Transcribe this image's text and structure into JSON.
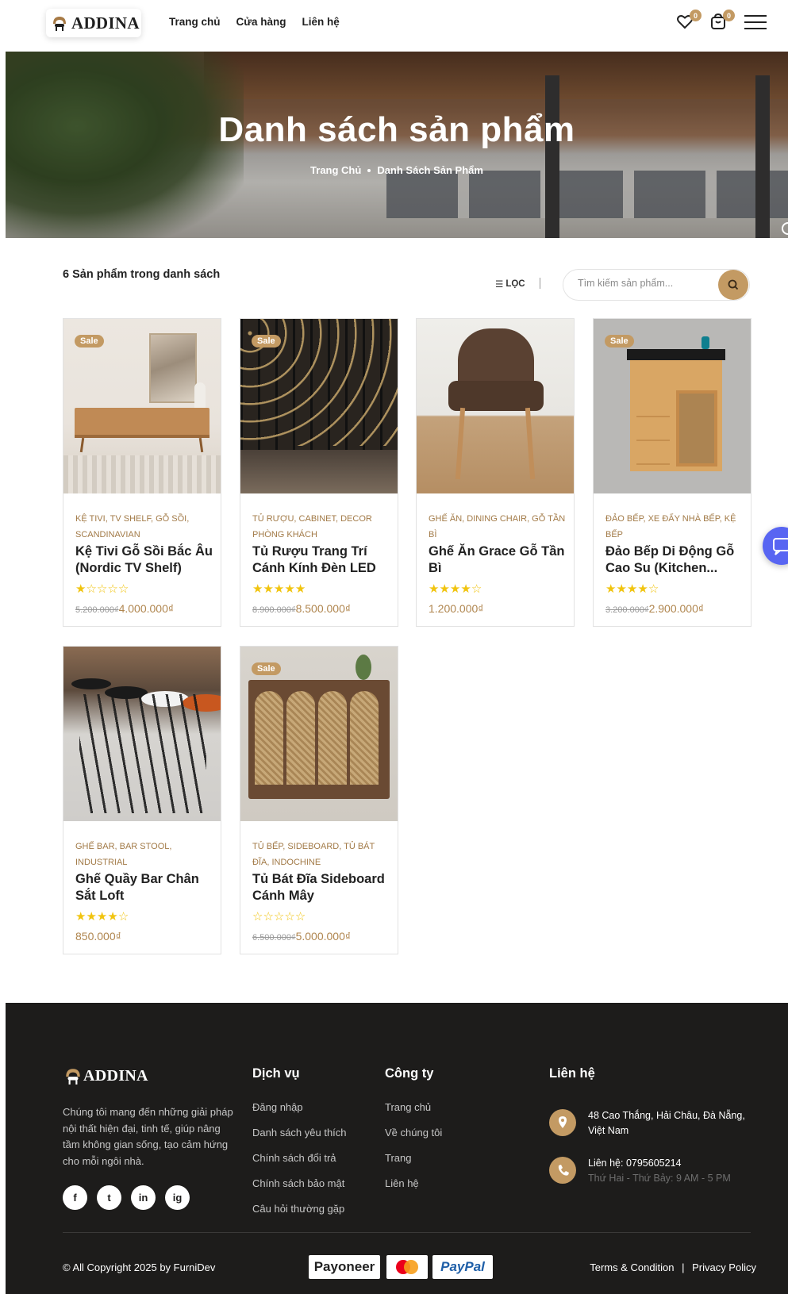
{
  "header": {
    "brand": "ADDINA",
    "nav": [
      "Trang chủ",
      "Cửa hàng",
      "Liên hệ"
    ],
    "wishlist_count": "0",
    "cart_count": "0"
  },
  "hero": {
    "title": "Danh sách sản phẩm",
    "breadcrumb_home": "Trang Chủ",
    "breadcrumb_current": "Danh Sách Sản Phẩm"
  },
  "toolbar": {
    "count_text": "6 Sản phẩm trong danh sách",
    "filter_label": "LỌC",
    "search_placeholder": "Tìm kiếm sản phẩm..."
  },
  "products": [
    {
      "sale": "Sale",
      "categories": "KỆ TIVI, TV SHELF, GỖ SỒI, SCANDINAVIAN",
      "name": "Kệ Tivi Gỗ Sồi Bắc Âu (Nordic TV Shelf)",
      "rating": 1,
      "old_price": "5.200.000₫",
      "price": "4.000.000₫"
    },
    {
      "sale": "Sale",
      "categories": "TỦ RƯỢU, CABINET, DECOR PHÒNG KHÁCH",
      "name": "Tủ Rượu Trang Trí Cánh Kính Đèn LED",
      "rating": 5,
      "old_price": "8.900.000₫",
      "price": "8.500.000₫"
    },
    {
      "sale": "",
      "categories": "GHẾ ĂN, DINING CHAIR, GỖ TẦN BÌ",
      "name": "Ghế Ăn Grace Gỗ Tần Bì",
      "rating": 4,
      "old_price": "",
      "price": "1.200.000₫"
    },
    {
      "sale": "Sale",
      "categories": "ĐẢO BẾP, XE ĐẨY NHÀ BẾP, KỆ BẾP",
      "name": "Đảo Bếp Di Động Gỗ Cao Su (Kitchen...",
      "rating": 4,
      "old_price": "3.200.000₫",
      "price": "2.900.000₫"
    },
    {
      "sale": "",
      "categories": "GHẾ BAR, BAR STOOL, INDUSTRIAL",
      "name": "Ghế Quầy Bar Chân Sắt Loft",
      "rating": 4,
      "old_price": "",
      "price": "850.000₫"
    },
    {
      "sale": "Sale",
      "categories": "TỦ BẾP, SIDEBOARD, TỦ BÁT ĐĨA, INDOCHINE",
      "name": "Tủ Bát Đĩa Sideboard Cánh Mây",
      "rating": 0,
      "old_price": "6.500.000₫",
      "price": "5.000.000₫"
    }
  ],
  "footer": {
    "brand": "ADDINA",
    "description": "Chúng tôi mang đến những giải pháp nội thất hiện đại, tinh tế, giúp nâng tầm không gian sống, tạo cảm hứng cho mỗi ngôi nhà.",
    "social": [
      "f",
      "t",
      "in",
      "ig"
    ],
    "services_title": "Dịch vụ",
    "services": [
      "Đăng nhập",
      "Danh sách yêu thích",
      "Chính sách đổi trả",
      "Chính sách bảo mật",
      "Câu hỏi thường gặp"
    ],
    "company_title": "Công ty",
    "company": [
      "Trang chủ",
      "Về chúng tôi",
      "Trang",
      "Liên hệ"
    ],
    "contact_title": "Liên hệ",
    "address": "48 Cao Thắng, Hải Châu, Đà Nẵng, Việt Nam",
    "phone": "Liên hệ: 0795605214",
    "hours": "Thứ Hai - Thứ Bảy: 9 AM - 5 PM",
    "copyright": "© All Copyright 2025 by FurniDev",
    "payments": [
      "Payoneer",
      "MasterCard",
      "PayPal"
    ],
    "terms": "Terms & Condition",
    "privacy": "Privacy Policy"
  },
  "colors": {
    "accent": "#c39a63",
    "footer_bg": "#1d1c1b",
    "chat": "#5865f2"
  }
}
